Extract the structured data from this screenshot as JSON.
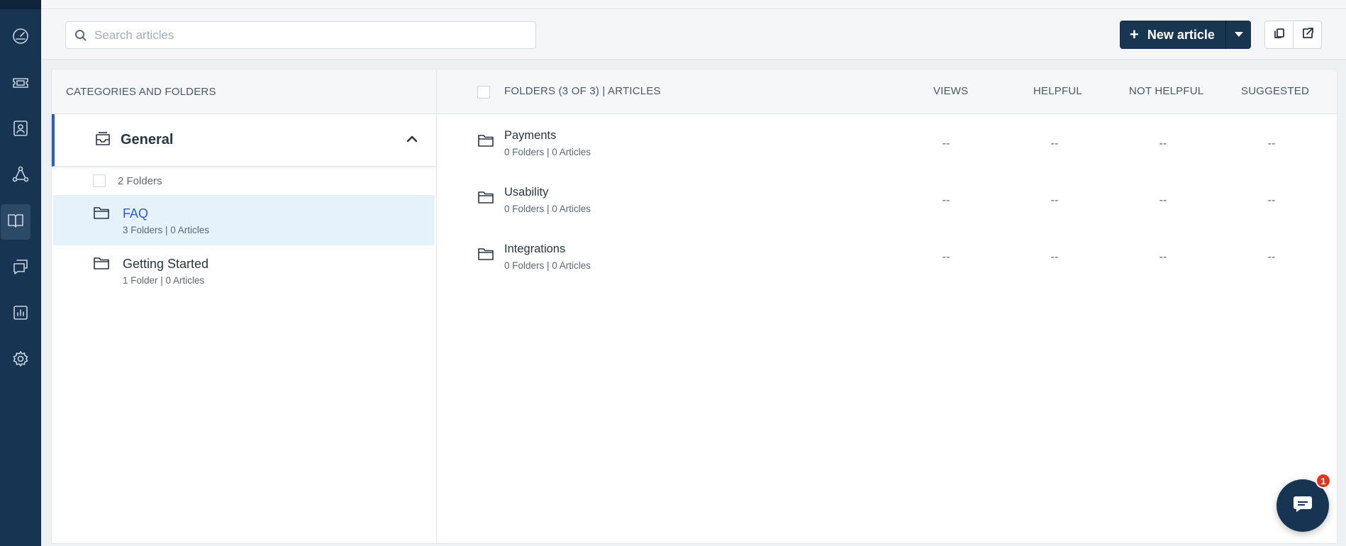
{
  "search": {
    "placeholder": "Search articles"
  },
  "toolbar": {
    "new_article_label": "New article",
    "plus": "+"
  },
  "categories_header": "CATEGORIES AND FOLDERS",
  "category": {
    "title": "General"
  },
  "folder_count_label": "2 Folders",
  "left_folders": [
    {
      "name": "FAQ",
      "meta": "3 Folders | 0 Articles",
      "selected": true
    },
    {
      "name": "Getting Started",
      "meta": "1 Folder | 0 Articles",
      "selected": false
    }
  ],
  "table": {
    "headers": {
      "name": "FOLDERS (3 OF 3) | ARTICLES",
      "views": "VIEWS",
      "helpful": "HELPFUL",
      "not_helpful": "NOT HELPFUL",
      "suggested": "SUGGESTED"
    },
    "rows": [
      {
        "name": "Payments",
        "meta": "0 Folders | 0 Articles",
        "views": "--",
        "helpful": "--",
        "not_helpful": "--",
        "suggested": "--"
      },
      {
        "name": "Usability",
        "meta": "0 Folders | 0 Articles",
        "views": "--",
        "helpful": "--",
        "not_helpful": "--",
        "suggested": "--"
      },
      {
        "name": "Integrations",
        "meta": "0 Folders | 0 Articles",
        "views": "--",
        "helpful": "--",
        "not_helpful": "--",
        "suggested": "--"
      }
    ]
  },
  "chat": {
    "badge": "1"
  },
  "nav_icons": [
    "dashboard-icon",
    "tickets-icon",
    "contacts-icon",
    "social-icon",
    "knowledge-base-icon",
    "conversations-icon",
    "reports-icon",
    "settings-icon"
  ],
  "colors": {
    "nav_bg": "#173552",
    "accent": "#2c5cc5",
    "selected_bg": "#e5f2fc",
    "badge": "#e2371f"
  }
}
